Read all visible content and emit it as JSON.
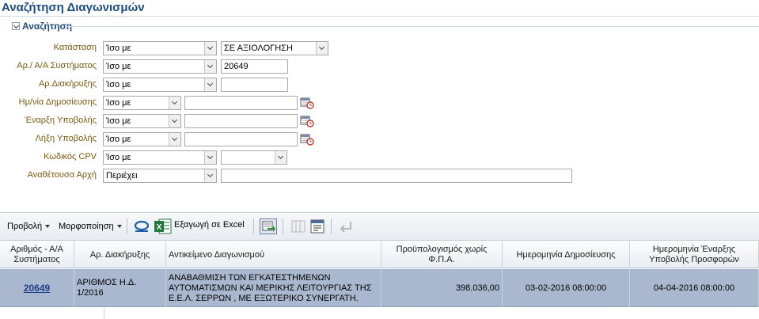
{
  "page": {
    "title": "Αναζήτηση Διαγωνισμών"
  },
  "search": {
    "header": "Αναζήτηση",
    "fields": [
      {
        "label": "Κατάσταση",
        "operator": "Ίσο με",
        "value": "ΣΕ ΑΞΙΟΛΟΓΗΣΗ"
      },
      {
        "label": "Αρ./ Α/Α Συστήματος",
        "operator": "Ίσο με",
        "value": "20649"
      },
      {
        "label": "Αρ.Διακήρυξης",
        "operator": "Ίσο με",
        "value": ""
      },
      {
        "label": "Ημ/νία Δημοσίευσης",
        "operator": "Ίσο με",
        "value": ""
      },
      {
        "label": "Έναρξη Υποβολής",
        "operator": "Ίσο με",
        "value": ""
      },
      {
        "label": "Λήξη Υποβολής",
        "operator": "Ίσο με",
        "value": ""
      },
      {
        "label": "Κωδικός CPV",
        "operator": "Ίσο με",
        "value": ""
      },
      {
        "label": "Αναθέτουσα Αρχή",
        "operator": "Περιέχει",
        "value": ""
      }
    ]
  },
  "toolbar": {
    "view_label": "Προβολή",
    "format_label": "Μορφοποίηση",
    "excel_label": "Εξαγωγή σε Excel"
  },
  "table": {
    "columns": [
      "Αριθμός - Α/Α Συστήματος",
      "Αρ. Διακήρυξης",
      "Αντικείμενο Διαγωνισμού",
      "Προϋπολογισμός χωρίς Φ.Π.Α.",
      "Ημερομηνία Δημοσίευσης",
      "Ημερομηνία Έναρξης Υποβολής Προσφορών"
    ],
    "rows": [
      {
        "system_id": "20649",
        "declaration_no": "ΑΡΙΘΜΟΣ Η.Δ. 1/2016",
        "subject": "ΑΝΑΒΑΘΜΙΣΗ ΤΩΝ ΕΓΚΑΤΕΣΤΗΜΕΝΩΝ ΑΥΤΟΜΑΤΙΣΜΩΝ ΚΑΙ ΜΕΡΙΚΗΣ ΛΕΙΤΟΥΡΓΙΑΣ ΤΗΣ Ε.Ε.Λ. ΣΕΡΡΩΝ , ΜΕ ΕΞΩΤΕΡΙΚΟ ΣΥΝΕΡΓΑΤΗ.",
        "budget": "398.036,00",
        "publication_date": "03-02-2016 08:00:00",
        "submission_start": "04-04-2016 08:00:00"
      }
    ]
  },
  "colors": {
    "title": "#1c4d80",
    "label": "#7b5a0e",
    "selected_row": "#a9b8ce",
    "link": "#1c3f86",
    "excel_green": "#1f7a3a"
  },
  "icons": [
    "collapse-icon",
    "calendar-icon",
    "oracle-icon",
    "excel-icon",
    "detach-icon",
    "freeze-icon",
    "wrap-icon",
    "go-back-icon"
  ]
}
